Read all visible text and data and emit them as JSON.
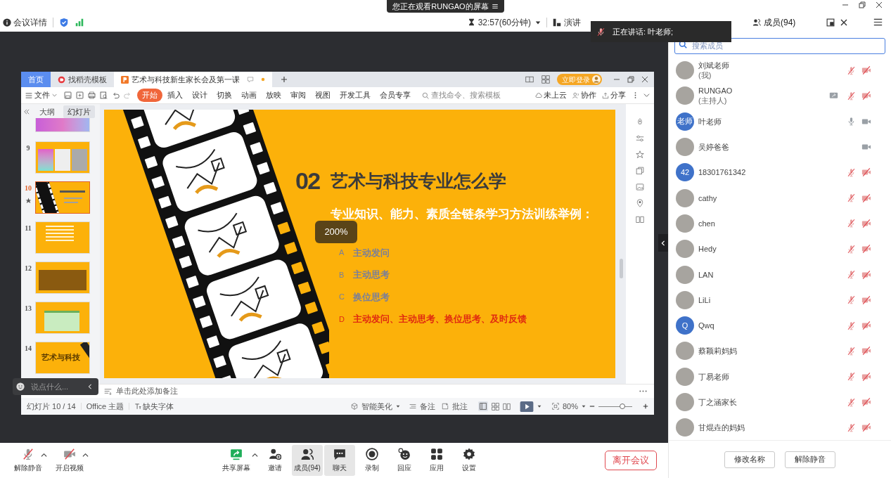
{
  "banner": {
    "text": "您正在观看RUNGAO的屏幕"
  },
  "header": {
    "meeting_info": "会议详情",
    "timer": "32:57(60分钟)",
    "view_button": "演讲"
  },
  "speaking": {
    "text": "正在讲话: 叶老师;"
  },
  "panel": {
    "tabs": [
      {
        "label": "成员(94)",
        "selected": true
      }
    ],
    "search": {
      "placeholder": "搜索成员"
    },
    "members": [
      {
        "name": "刘斌老师",
        "note": "(我)",
        "avatar": {
          "kind": "photo"
        },
        "mic_muted": true,
        "video_off": true,
        "sharing": false
      },
      {
        "name": "RUNGAO",
        "note": "(主持人)",
        "avatar": {
          "kind": "photo"
        },
        "mic_muted": true,
        "video_off": true,
        "sharing": true
      },
      {
        "name": "叶老师",
        "avatar": {
          "kind": "initials",
          "text": "老师"
        },
        "mic_muted": false,
        "video_off": false,
        "sharing": false
      },
      {
        "name": "吴婷爸爸",
        "avatar": {
          "kind": "photo"
        },
        "video_off": false,
        "sharing": false
      },
      {
        "name": "18301761342",
        "avatar": {
          "kind": "initials",
          "text": "42"
        },
        "mic_muted": true,
        "video_off": true,
        "sharing": false
      },
      {
        "name": "cathy",
        "avatar": {
          "kind": "photo"
        },
        "mic_muted": true,
        "video_off": true,
        "sharing": false
      },
      {
        "name": "chen",
        "avatar": {
          "kind": "photo"
        },
        "mic_muted": true,
        "video_off": true,
        "sharing": false
      },
      {
        "name": "Hedy",
        "avatar": {
          "kind": "photo"
        },
        "mic_muted": true,
        "video_off": true,
        "sharing": false
      },
      {
        "name": "LAN",
        "avatar": {
          "kind": "photo"
        },
        "mic_muted": true,
        "video_off": true,
        "sharing": false
      },
      {
        "name": "LiLi",
        "avatar": {
          "kind": "photo"
        },
        "mic_muted": true,
        "video_off": true,
        "sharing": false
      },
      {
        "name": "Qwq",
        "avatar": {
          "kind": "initials",
          "text": "Q"
        },
        "mic_muted": true,
        "video_off": true,
        "sharing": false
      },
      {
        "name": "蔡颖莉妈妈",
        "avatar": {
          "kind": "photo"
        },
        "mic_muted": true,
        "video_off": true,
        "sharing": false
      },
      {
        "name": "丁易老师",
        "avatar": {
          "kind": "photo"
        },
        "mic_muted": true,
        "video_off": true,
        "sharing": false
      },
      {
        "name": "丁之涵家长",
        "avatar": {
          "kind": "photo"
        },
        "mic_muted": true,
        "video_off": true,
        "sharing": false
      },
      {
        "name": "甘焜垚的妈妈",
        "avatar": {
          "kind": "photo"
        },
        "mic_muted": true,
        "video_off": true,
        "sharing": false
      }
    ],
    "buttons": [
      "修改名称",
      "解除静音"
    ]
  },
  "shared_window": {
    "tabs": [
      {
        "label": "首页",
        "kind": "home",
        "selected": false
      },
      {
        "label": "找稻壳模板",
        "kind": "template",
        "selected": false
      },
      {
        "label": "艺术与科技新生家长会及第一课",
        "kind": "document",
        "selected": true
      }
    ],
    "login": "立即登录",
    "file_menu": "文件",
    "menu": [
      {
        "label": "开始",
        "selected": true
      },
      {
        "label": "插入",
        "selected": false
      },
      {
        "label": "设计",
        "selected": false
      },
      {
        "label": "切换",
        "selected": false
      },
      {
        "label": "动画",
        "selected": false
      },
      {
        "label": "放映",
        "selected": false
      },
      {
        "label": "审阅",
        "selected": false
      },
      {
        "label": "视图",
        "selected": false
      },
      {
        "label": "开发工具",
        "selected": false
      },
      {
        "label": "会员专享",
        "selected": false
      }
    ],
    "search": {
      "placeholder": "查找命令、搜索模板"
    },
    "actions": [
      "未上云",
      "协作",
      "分享"
    ],
    "pane_tabs": [
      {
        "label": "大纲",
        "selected": false
      },
      {
        "label": "幻灯片",
        "selected": true
      }
    ],
    "thumbnails": [
      {
        "kind": "gradient",
        "selected": false,
        "starred": false
      },
      {
        "number": "9",
        "kind": "photos",
        "selected": false,
        "starred": false
      },
      {
        "number": "10",
        "kind": "film",
        "selected": true,
        "starred": true
      },
      {
        "number": "11",
        "kind": "text",
        "selected": false,
        "starred": false
      },
      {
        "number": "12",
        "kind": "table",
        "selected": false,
        "starred": false
      },
      {
        "number": "13",
        "kind": "green-table",
        "selected": false,
        "starred": false
      },
      {
        "number": "14",
        "kind": "title",
        "title": "艺术与科技",
        "selected": false,
        "starred": false
      }
    ],
    "slide": {
      "number": "02",
      "title": "艺术与科技专业怎么学",
      "subtitle": "专业知识、能力、素质全链条学习方法训练举例：",
      "items": [
        {
          "letter": "A",
          "text": "主动发问",
          "highlight": false
        },
        {
          "letter": "B",
          "text": "主动思考",
          "highlight": false
        },
        {
          "letter": "C",
          "text": "换位思考",
          "highlight": false
        },
        {
          "letter": "D",
          "text": "主动发问、主动思考、换位思考、及时反馈",
          "highlight": true
        }
      ]
    },
    "zoom_tooltip": "200%",
    "notes_placeholder": "单击此处添加备注",
    "status": {
      "slide": "幻灯片 10 / 14",
      "theme": "Office 主题",
      "fonts": "缺失字体",
      "beautify": "智能美化",
      "notes": "备注",
      "comments": "批注",
      "zoom": "80%",
      "zoom_slider": {
        "level": 0.7
      }
    }
  },
  "chat_input": {
    "placeholder": "说点什么..."
  },
  "toolbar": {
    "left": [
      {
        "label": "解除静音",
        "kind": "mic",
        "muted": true
      },
      {
        "label": "开启视频",
        "kind": "video",
        "muted": true
      }
    ],
    "center": [
      {
        "label": "共享屏幕",
        "kind": "share",
        "selected": false
      },
      {
        "label": "邀请",
        "kind": "invite",
        "selected": false
      },
      {
        "label": "成员(94)",
        "kind": "members",
        "selected": true
      },
      {
        "label": "聊天",
        "kind": "chat",
        "selected": true
      },
      {
        "label": "录制",
        "kind": "record",
        "selected": false
      },
      {
        "label": "回应",
        "kind": "react",
        "selected": false
      },
      {
        "label": "应用",
        "kind": "apps",
        "selected": false
      },
      {
        "label": "设置",
        "kind": "settings",
        "selected": false
      }
    ],
    "leave": "离开会议"
  }
}
